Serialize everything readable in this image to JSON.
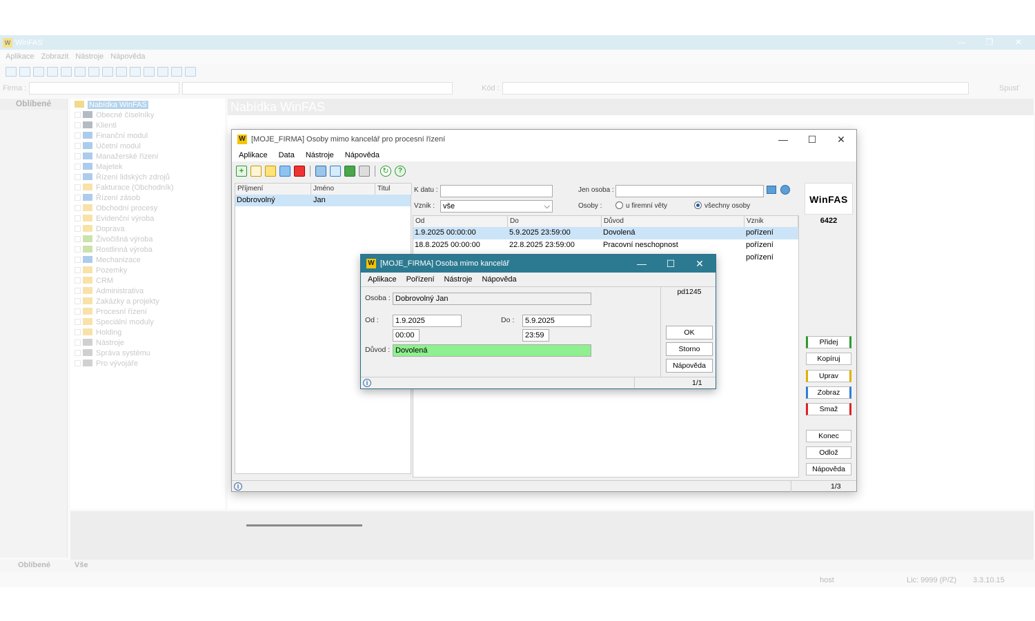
{
  "app": {
    "title": "WinFAS",
    "menu": [
      "Aplikace",
      "Zobrazit",
      "Nástroje",
      "Nápověda"
    ],
    "firma_label": "Firma :",
    "kod_label": "Kód :",
    "spust_label": "Spusť",
    "favorites_header": "Oblíbené",
    "nabidka_title": "Nabídka WinFAS",
    "tree_root": "Nabídka WinFAS",
    "tree_items": [
      "Obecné číselníky",
      "Klienti",
      "Finanční modul",
      "Účetní modul",
      "Manažerské řízení",
      "Majetek",
      "Řízení lidských zdrojů",
      "Fakturace (Obchodník)",
      "Řízení zásob",
      "Obchodní procesy",
      "Evidenční výroba",
      "Doprava",
      "Živočišná výroba",
      "Rostlinná výroba",
      "Mechanizace",
      "Pozemky",
      "CRM",
      "Administrativa",
      "Zakázky a projekty",
      "Procesní řízení",
      "Speciální moduly",
      "Holding",
      "Nástroje",
      "Správa systému",
      "Pro vývojáře"
    ],
    "bottom_tabs": [
      "Oblíbené",
      "Vše"
    ],
    "status": {
      "user": "host",
      "lic": "Lic: 9999 (P/Z)",
      "version": "3.3.10.15"
    }
  },
  "win1": {
    "title": "[MOJE_FIRMA] Osoby mimo kancelář pro procesní řízení",
    "menu": [
      "Aplikace",
      "Data",
      "Nástroje",
      "Nápověda"
    ],
    "persons_headers": [
      "Příjmení",
      "Jméno",
      "Titul"
    ],
    "persons_rows": [
      [
        "Dobrovolný",
        "Jan",
        ""
      ]
    ],
    "filter": {
      "k_datu_label": "K datu :",
      "k_datu_value": "",
      "jen_osoba_label": "Jen osoba :",
      "jen_osoba_value": "",
      "vznik_label": "Vznik :",
      "vznik_value": "vše",
      "osoby_label": "Osoby :",
      "radio1": "u firemní věty",
      "radio2": "všechny osoby"
    },
    "absence_headers": [
      "Od",
      "Do",
      "Důvod",
      "Vznik"
    ],
    "absence_rows": [
      [
        "1.9.2025 00:00:00",
        "5.9.2025 23:59:00",
        "Dovolená",
        "pořízení"
      ],
      [
        "18.8.2025 00:00:00",
        "22.8.2025 23:59:00",
        "Pracovní neschopnost",
        "pořízení"
      ],
      [
        "",
        "",
        "",
        "pořízení"
      ]
    ],
    "logo_text": "WinFAS",
    "code": "6422",
    "buttons": [
      "Přidej",
      "Kopíruj",
      "Uprav",
      "Zobraz",
      "Smaž",
      "Konec",
      "Odlož",
      "Nápověda"
    ],
    "pager": "1/3"
  },
  "win2": {
    "title": "[MOJE_FIRMA] Osoba mimo kancelář",
    "menu": [
      "Aplikace",
      "Pořízení",
      "Nástroje",
      "Nápověda"
    ],
    "code": "pd1245",
    "osoba_label": "Osoba :",
    "osoba_value": "Dobrovolný Jan",
    "od_label": "Od :",
    "od_date": "1.9.2025",
    "od_time": "00:00",
    "do_label": "Do :",
    "do_date": "5.9.2025",
    "do_time": "23:59",
    "duvod_label": "Důvod :",
    "duvod_value": "Dovolená",
    "ok": "OK",
    "storno": "Storno",
    "napoveda": "Nápověda",
    "pager": "1/1"
  },
  "colors": {
    "accent": "#2c7a91",
    "selection": "#cce4f7",
    "duvod_bg": "#8ef08e",
    "add": "#2e9a2e",
    "edit": "#e0b000",
    "view": "#2f7fd6",
    "delete": "#d22"
  }
}
